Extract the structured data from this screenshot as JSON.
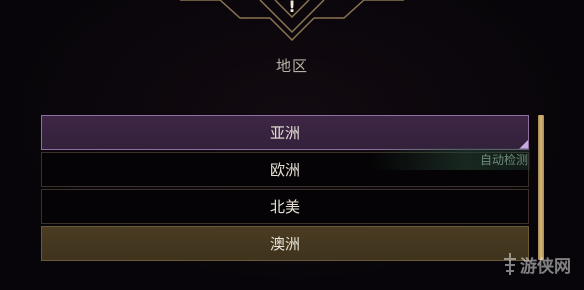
{
  "emblem": {
    "icon": "exclamation-icon",
    "glyph": "!"
  },
  "region": {
    "title": "地区",
    "options": [
      {
        "label": "亚洲",
        "state": "selected"
      },
      {
        "label": "欧洲",
        "state": "normal"
      },
      {
        "label": "北美",
        "state": "normal"
      },
      {
        "label": "澳洲",
        "state": "highlight"
      }
    ],
    "auto_detect_label": "自动检测"
  },
  "watermark": {
    "text": "游侠网"
  },
  "colors": {
    "selected_bg": "#3d2645",
    "highlight_bg": "#4a3c22",
    "scrollbar": "#d6b878",
    "frame_gold": "#a88a55"
  }
}
